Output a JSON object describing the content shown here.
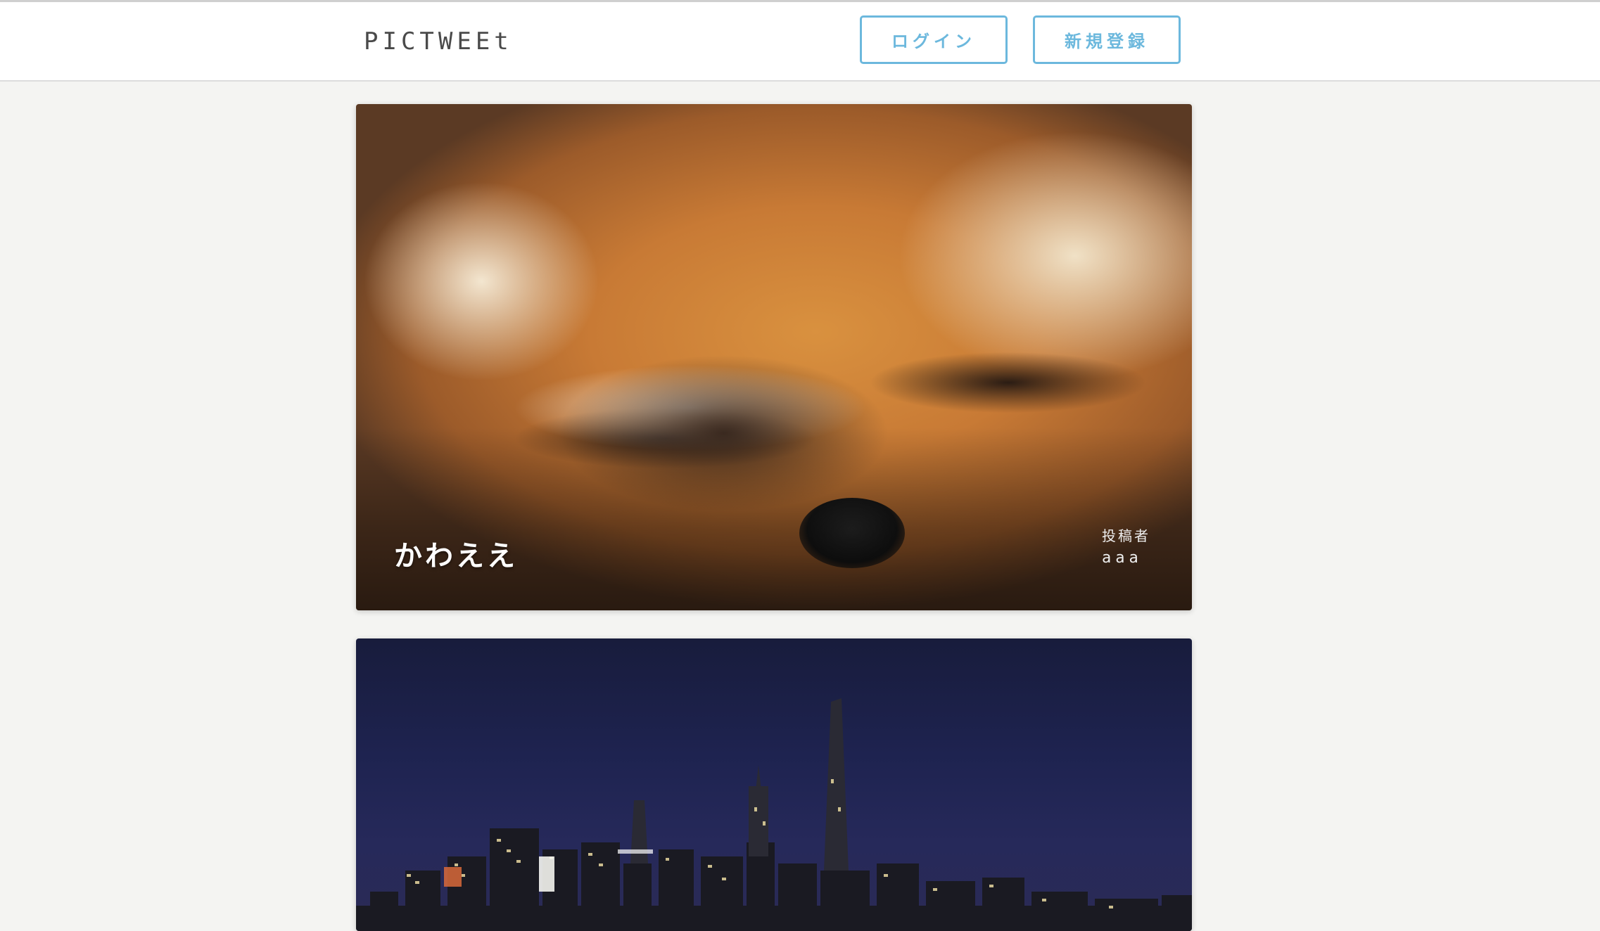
{
  "app": {
    "logo": "PICTWEEt"
  },
  "header": {
    "login_label": "ログイン",
    "signup_label": "新規登録"
  },
  "posts": [
    {
      "title": "かわええ",
      "poster_label": "投稿者",
      "poster_name": "aaa",
      "image": "fox-photo"
    },
    {
      "title": "",
      "poster_label": "",
      "poster_name": "",
      "image": "city-night-skyline-photo"
    }
  ],
  "colors": {
    "accent": "#6cb8dd",
    "background": "#f4f4f2",
    "header_bg": "#ffffff"
  }
}
